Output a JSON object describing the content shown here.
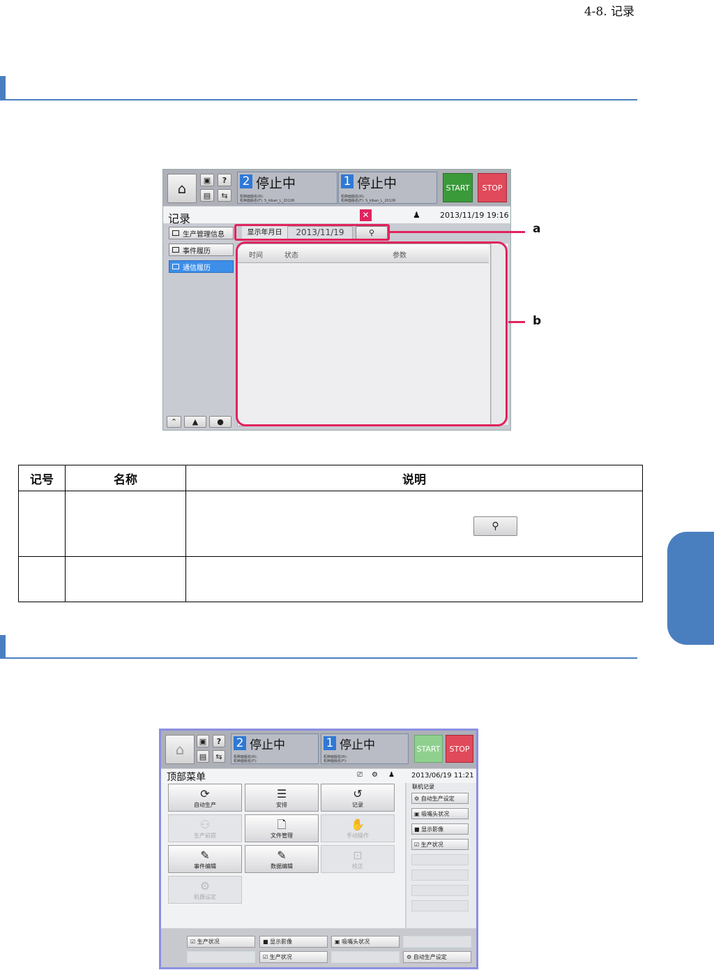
{
  "page_header": "4-8.  记录",
  "fig1": {
    "status_left": {
      "num": "2",
      "text": "停止中",
      "line1": "机种面版名(R):",
      "line2": "机种面版名(F): S_kiban_L_2012R"
    },
    "status_right": {
      "num": "1",
      "text": "停止中",
      "line1": "机种面版名(R):",
      "line2": "机种面版名(F): S_kiban_L_2012R"
    },
    "start_label": "START",
    "stop_label": "STOP",
    "screen_title": "记录",
    "datetime": "2013/11/19 19:16",
    "sidebar": [
      "生产管理信息",
      "事件履历",
      "通信履历"
    ],
    "date_label": "显示年月日",
    "date_value": "2013/11/19",
    "columns": [
      "时间",
      "状态",
      "参数"
    ],
    "callout_a": "a",
    "callout_b": "b",
    "colors": {
      "accent": "#3d8ee8",
      "highlight": "#e0245e",
      "start": "#3a9a3a",
      "stop": "#e04a5a"
    }
  },
  "table": {
    "headers": [
      "记号",
      "名称",
      "说明"
    ],
    "rows": [
      {
        "mark": "",
        "name": "",
        "desc": ""
      },
      {
        "mark": "",
        "name": "",
        "desc": ""
      }
    ]
  },
  "fig2": {
    "status_left": {
      "num": "2",
      "text": "停止中",
      "line1": "机种面版名(R):",
      "line2": "机种面版名(F):"
    },
    "status_right": {
      "num": "1",
      "text": "停止中",
      "line1": "机种面版名(R):",
      "line2": "机种面版名(F):"
    },
    "start_label": "START",
    "stop_label": "STOP",
    "screen_title": "顶部菜单",
    "datetime": "2013/06/19 11:21",
    "menu": [
      "自动生产",
      "安排",
      "记录",
      "生产前提",
      "文件管理",
      "手动操作",
      "事件编辑",
      "数据编辑",
      "校正",
      "机器设定"
    ],
    "right_header": "联机记录",
    "right_items": [
      "自动生产设定",
      "吸嘴头状况",
      "显示影像",
      "生产状况"
    ],
    "bottom_items": [
      "生产状况",
      "显示影像",
      "吸嘴头状况",
      "生产状况",
      "自动生产设定"
    ]
  }
}
